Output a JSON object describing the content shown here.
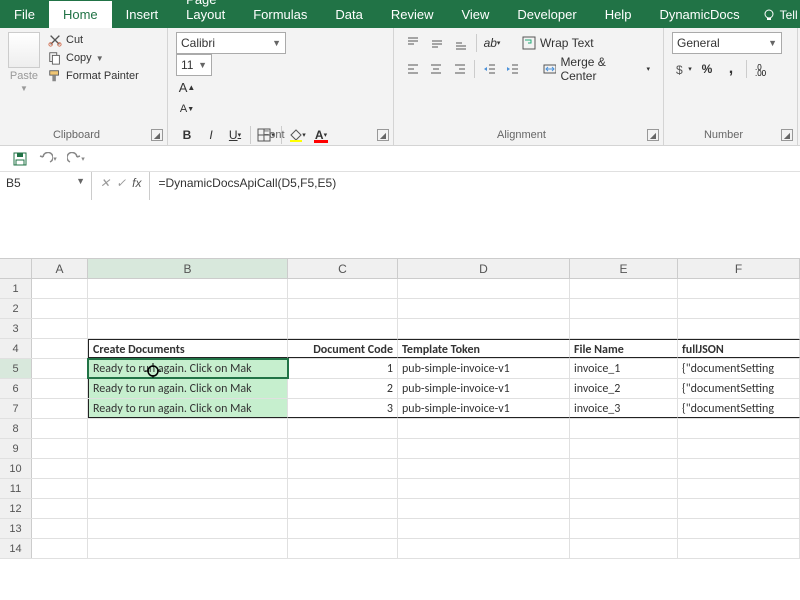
{
  "tabs": {
    "file": "File",
    "home": "Home",
    "insert": "Insert",
    "pagelayout": "Page Layout",
    "formulas": "Formulas",
    "data": "Data",
    "review": "Review",
    "view": "View",
    "developer": "Developer",
    "help": "Help",
    "dynamicdocs": "DynamicDocs",
    "tellme": "Tell"
  },
  "clipboard": {
    "paste": "Paste",
    "cut": "Cut",
    "copy": "Copy",
    "format_painter": "Format Painter",
    "group": "Clipboard"
  },
  "font": {
    "name": "Calibri",
    "size": "11",
    "group": "Font",
    "bold": "B",
    "italic": "I",
    "underline": "U"
  },
  "alignment": {
    "wrap": "Wrap Text",
    "merge": "Merge & Center",
    "group": "Alignment"
  },
  "number": {
    "format": "General",
    "group": "Number",
    "percent": "%",
    "comma": ","
  },
  "namebox": "B5",
  "formula": "=DynamicDocsApiCall(D5,F5,E5)",
  "cols": {
    "A": "A",
    "B": "B",
    "C": "C",
    "D": "D",
    "E": "E",
    "F": "F"
  },
  "rownums": [
    "1",
    "2",
    "3",
    "4",
    "5",
    "6",
    "7",
    "8",
    "9",
    "10",
    "11",
    "12",
    "13",
    "14"
  ],
  "headers": {
    "B": "Create Documents",
    "C": "Document Code",
    "D": "Template Token",
    "E": "File Name",
    "F": "fullJSON"
  },
  "datarows": [
    {
      "B": "Ready to run again. Click on Mak",
      "C": "1",
      "D": "pub-simple-invoice-v1",
      "E": "invoice_1",
      "F": "{\"documentSetting"
    },
    {
      "B": "Ready to run again. Click on Mak",
      "C": "2",
      "D": "pub-simple-invoice-v1",
      "E": "invoice_2",
      "F": "{\"documentSetting"
    },
    {
      "B": "Ready to run again. Click on Mak",
      "C": "3",
      "D": "pub-simple-invoice-v1",
      "E": "invoice_3",
      "F": "{\"documentSetting"
    }
  ]
}
